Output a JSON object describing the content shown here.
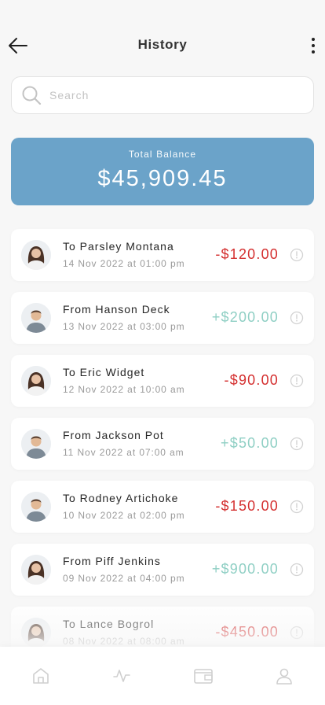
{
  "header": {
    "title": "History"
  },
  "search": {
    "placeholder": "Search",
    "value": ""
  },
  "balance": {
    "label": "Total Balance",
    "amount": "$45,909.45"
  },
  "colors": {
    "balance_card": "#6ba3c9",
    "negative": "#d42f2f",
    "positive": "#8fcfc4",
    "background": "#f7f7f7"
  },
  "transactions": [
    {
      "name": "To Parsley Montana",
      "date": "14 Nov 2022 at 01:00 pm",
      "amount": "-$120.00",
      "direction": "neg",
      "avatar": "female-avatar"
    },
    {
      "name": "From Hanson Deck",
      "date": "13 Nov 2022 at 03:00 pm",
      "amount": "+$200.00",
      "direction": "pos",
      "avatar": "male-avatar"
    },
    {
      "name": "To Eric Widget",
      "date": "12 Nov 2022 at 10:00 am",
      "amount": "-$90.00",
      "direction": "neg",
      "avatar": "female-avatar"
    },
    {
      "name": "From Jackson Pot",
      "date": "11 Nov 2022 at 07:00 am",
      "amount": "+$50.00",
      "direction": "pos",
      "avatar": "male-avatar"
    },
    {
      "name": "To Rodney Artichoke",
      "date": "10 Nov 2022 at 02:00 pm",
      "amount": "-$150.00",
      "direction": "neg",
      "avatar": "male-avatar"
    },
    {
      "name": "From Piff Jenkins",
      "date": "09 Nov 2022 at 04:00 pm",
      "amount": "+$900.00",
      "direction": "pos",
      "avatar": "female-avatar"
    },
    {
      "name": "To Lance Bogrol",
      "date": "08 Nov 2022 at 08:00 am",
      "amount": "-$450.00",
      "direction": "neg",
      "avatar": "female-avatar"
    }
  ],
  "tabbar": {
    "items": [
      {
        "icon": "home-icon"
      },
      {
        "icon": "activity-icon"
      },
      {
        "icon": "wallet-icon"
      },
      {
        "icon": "profile-icon"
      }
    ]
  }
}
